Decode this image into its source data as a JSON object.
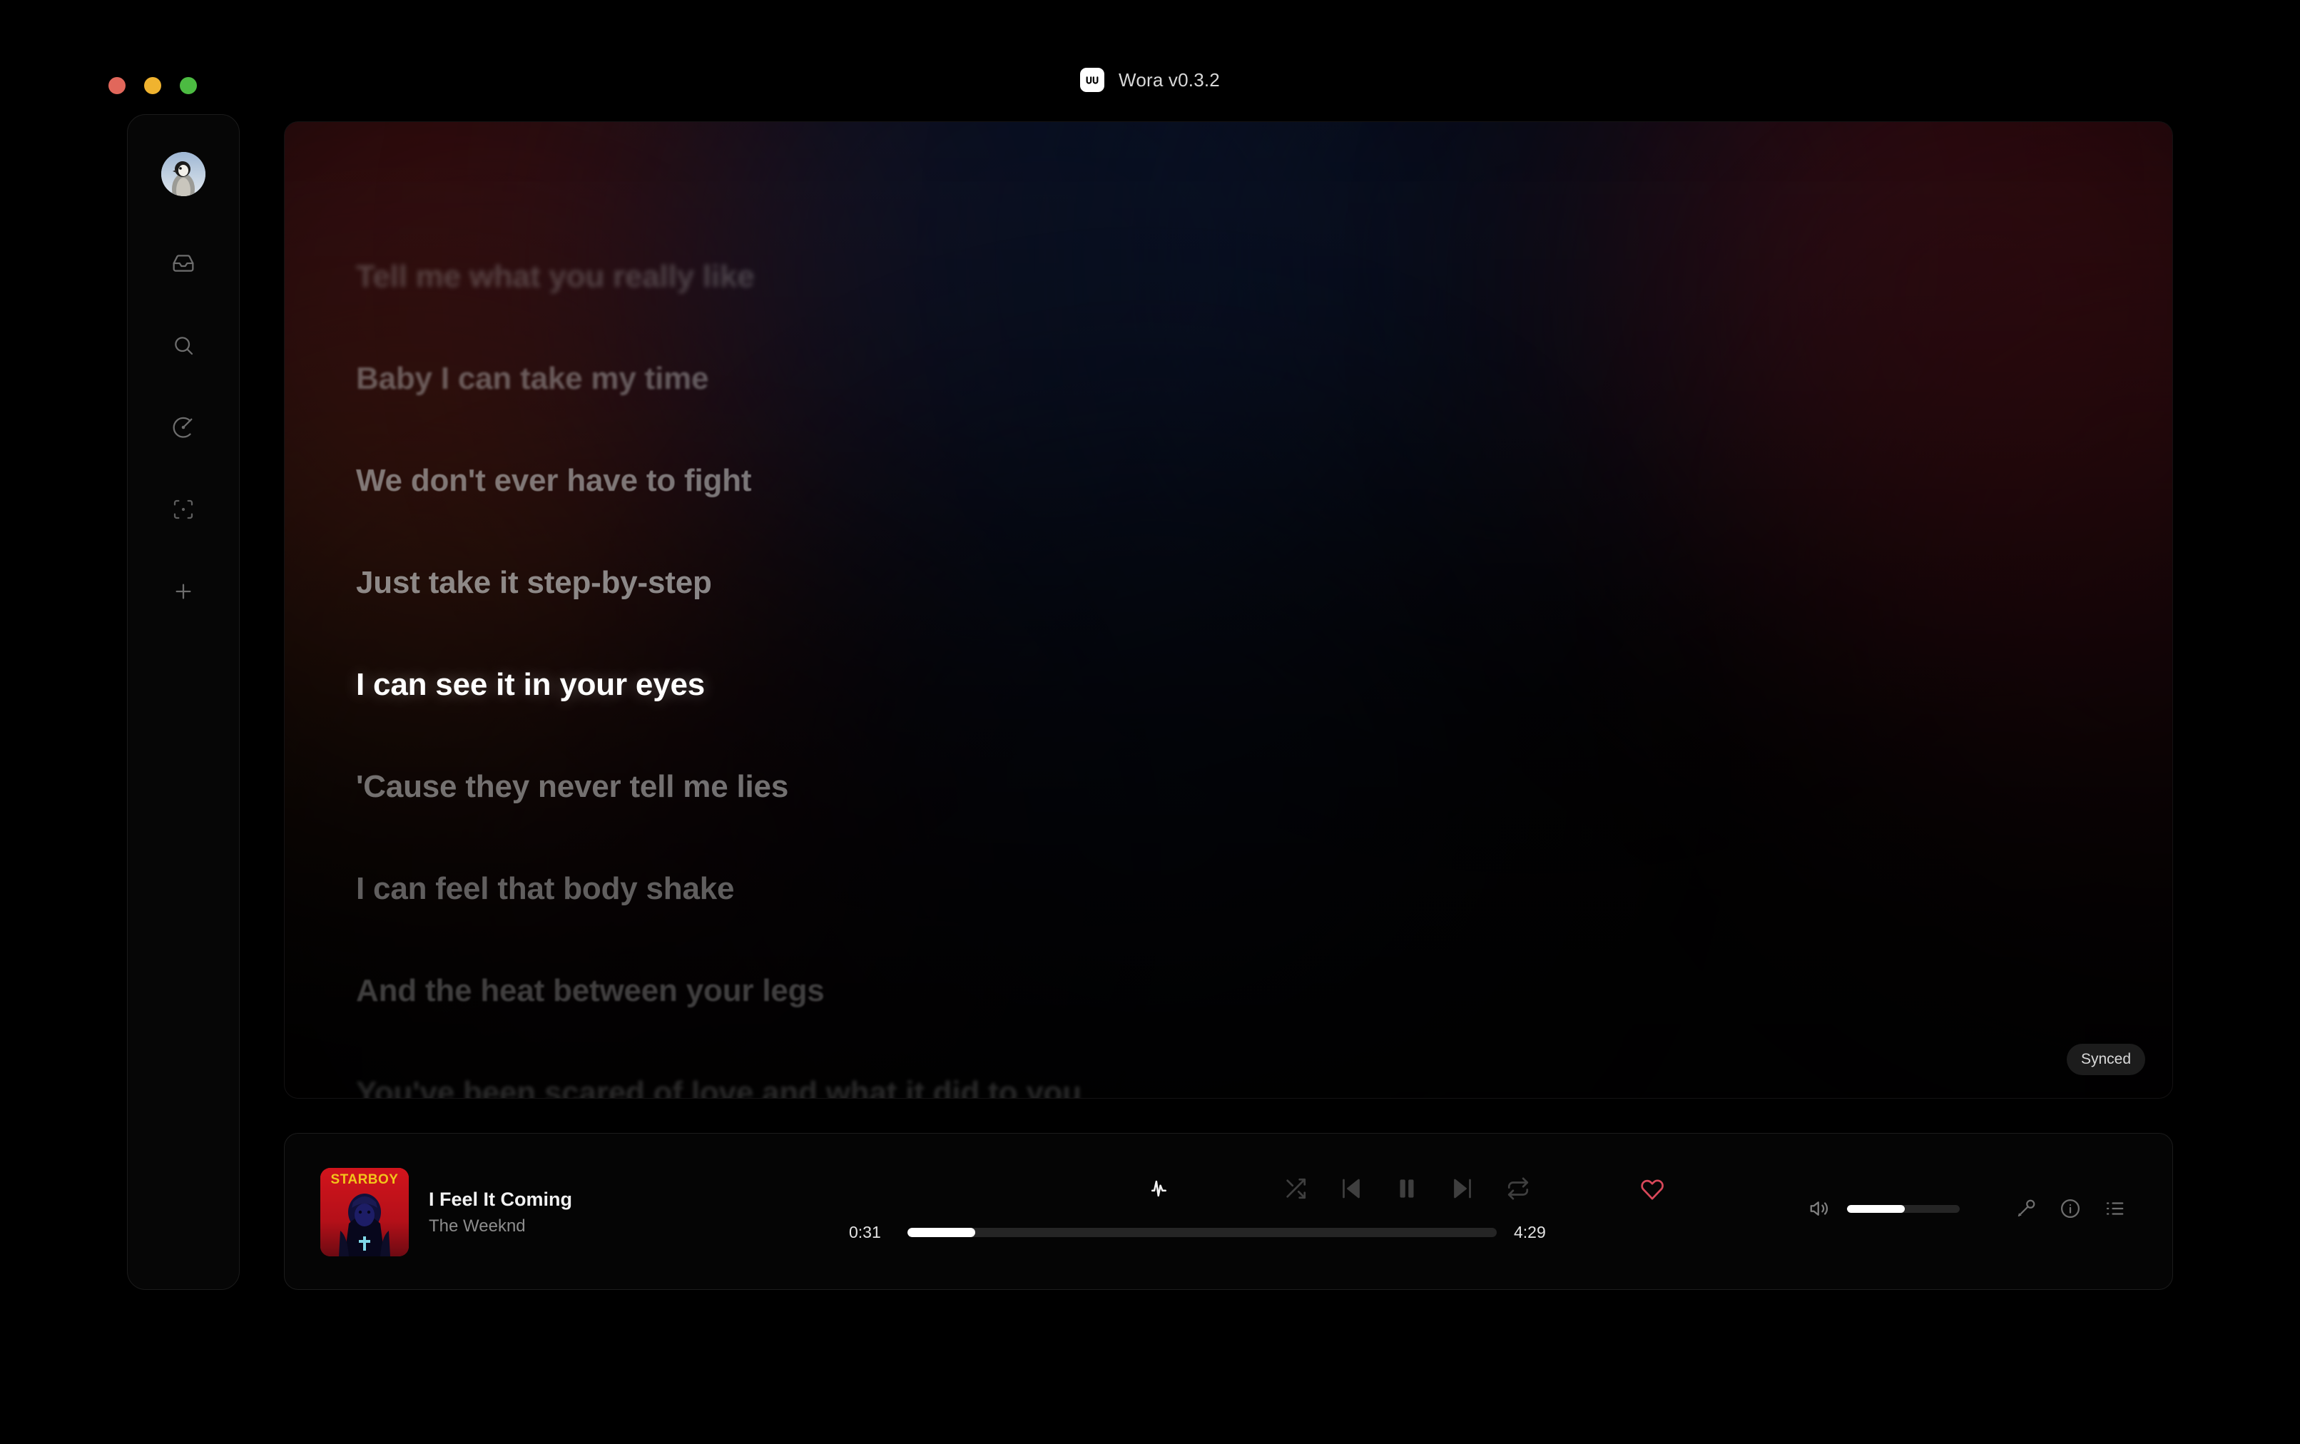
{
  "window": {
    "title": "Wora v0.3.2",
    "app_badge_icon": "wora-logo-icon",
    "traffic_lights": [
      {
        "name": "close",
        "color": "#e1675b"
      },
      {
        "name": "minimize",
        "color": "#f0b32f"
      },
      {
        "name": "maximize",
        "color": "#4cbb42"
      }
    ]
  },
  "sidebar": {
    "avatar": {
      "name": "user-avatar",
      "alt": "penguin"
    },
    "items": [
      {
        "icon": "library-inbox-icon",
        "label": "Library"
      },
      {
        "icon": "search-icon",
        "label": "Search"
      },
      {
        "icon": "vinyl-disc-icon",
        "label": "Playlists"
      },
      {
        "icon": "scan-focus-icon",
        "label": "Now Playing"
      },
      {
        "icon": "plus-icon",
        "label": "Add"
      }
    ]
  },
  "lyrics": {
    "badge": "Synced",
    "active_index": 4,
    "lines": [
      "Tell me what you really like",
      "Baby I can take my time",
      "We don't ever have to fight",
      "Just take it step-by-step",
      "I can see it in your eyes",
      "'Cause they never tell me lies",
      "I can feel that body shake",
      "And the heat between your legs",
      "You've been scared of love and what it did to you"
    ]
  },
  "player": {
    "now_playing": {
      "title": "I Feel It Coming",
      "artist": "The Weeknd",
      "album_art": "starboy-album-cover",
      "album_art_text": "STARBOY"
    },
    "transport": [
      {
        "icon": "audio-lines-icon",
        "label": "Visualizer",
        "active": true
      },
      {
        "icon": "shuffle-icon",
        "label": "Shuffle",
        "active": false
      },
      {
        "icon": "previous-track-icon",
        "label": "Previous",
        "active": false
      },
      {
        "icon": "pause-icon",
        "label": "Pause",
        "active": false
      },
      {
        "icon": "next-track-icon",
        "label": "Next",
        "active": false
      },
      {
        "icon": "repeat-icon",
        "label": "Repeat",
        "active": false
      },
      {
        "icon": "heart-icon",
        "label": "Favorite",
        "active": true
      }
    ],
    "progress": {
      "elapsed": "0:31",
      "duration": "4:29",
      "percent": 11.5
    },
    "right_controls": [
      {
        "icon": "volume-icon",
        "label": "Volume"
      },
      {
        "icon": "microphone-icon",
        "label": "Lyrics"
      },
      {
        "icon": "info-icon",
        "label": "Song info"
      },
      {
        "icon": "queue-list-icon",
        "label": "Queue"
      }
    ],
    "volume_percent": 51
  },
  "colors": {
    "accent_heart": "#d9485a",
    "panel_bg": "#060405",
    "text_primary": "#ffffff",
    "text_muted": "#8d8d8d"
  }
}
